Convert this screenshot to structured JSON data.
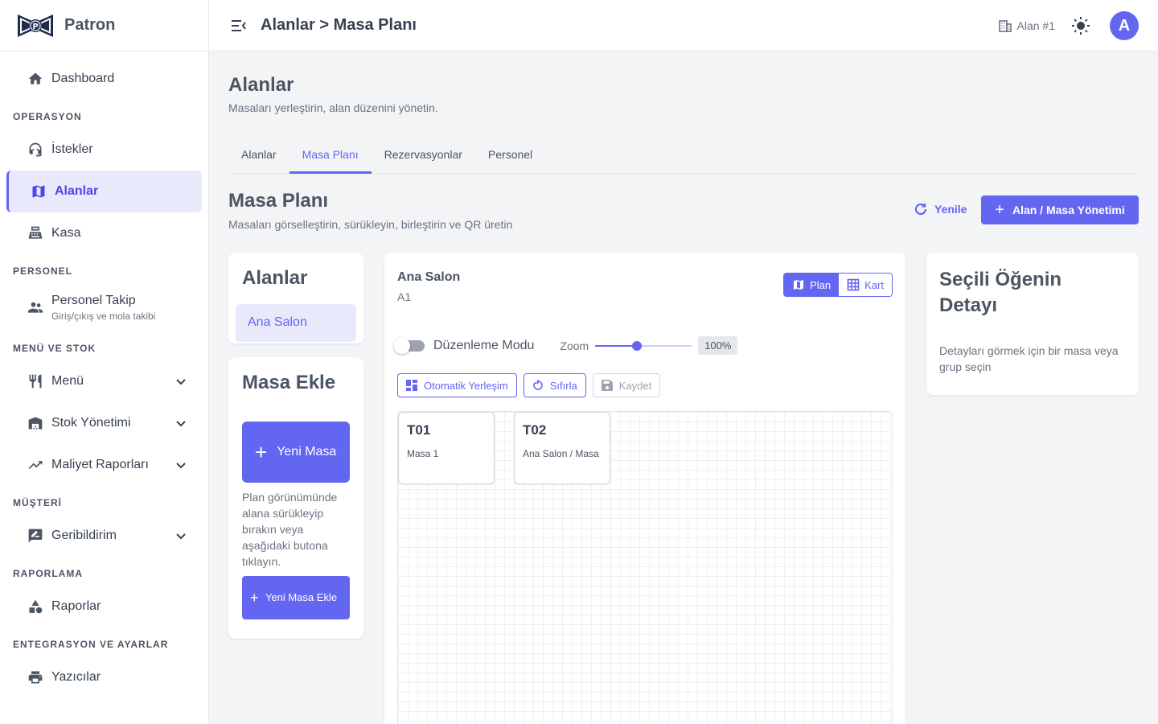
{
  "brand": {
    "name": "Patron"
  },
  "sidebar": {
    "dashboard": "Dashboard",
    "sections": {
      "operasyon": "OPERASYON",
      "personel": "PERSONEL",
      "menu_stok": "MENÜ VE STOK",
      "musteri": "MÜŞTERİ",
      "raporlama": "RAPORLAMA",
      "entegrasyon": "ENTEGRASYON VE AYARLAR"
    },
    "items": {
      "istekler": "İstekler",
      "alanlar": "Alanlar",
      "kasa": "Kasa",
      "personel_takip": "Personel Takip",
      "personel_takip_sub": "Giriş/çıkış ve mola takibi",
      "menu": "Menü",
      "stok": "Stok Yönetimi",
      "maliyet": "Maliyet Raporları",
      "geribildirim": "Geribildirim",
      "raporlar": "Raporlar",
      "yazicilar": "Yazıcılar"
    }
  },
  "topbar": {
    "breadcrumb": "Alanlar > Masa Planı",
    "area_chip": "Alan #1",
    "avatar_initial": "A"
  },
  "page": {
    "title": "Alanlar",
    "subtitle": "Masaları yerleştirin, alan düzenini yönetin.",
    "tabs": [
      "Alanlar",
      "Masa Planı",
      "Rezervasyonlar",
      "Personel"
    ],
    "active_tab": 1,
    "section_title": "Masa Planı",
    "section_subtitle": "Masaları görselleştirin, sürükleyin, birleştirin ve QR üretin",
    "refresh_label": "Yenile",
    "primary_label": "Alan / Masa Yönetimi"
  },
  "areas_card": {
    "title": "Alanlar",
    "items": [
      "Ana Salon"
    ]
  },
  "add_card": {
    "title": "Masa Ekle",
    "big_button": "Yeni Masa",
    "help": "Plan görünümünde alana sürükleyip bırakın veya aşağıdaki butona tıklayın.",
    "small_button": "Yeni Masa Ekle"
  },
  "plan": {
    "area_name": "Ana Salon",
    "area_code": "A1",
    "view_plan": "Plan",
    "view_card": "Kart",
    "edit_mode_label": "Düzenleme Modu",
    "edit_mode_on": false,
    "zoom_label": "Zoom",
    "zoom_percent": 100,
    "zoom_text": "100%",
    "auto_layout": "Otomatik Yerleşim",
    "reset": "Sıfırla",
    "save": "Kaydet",
    "tables": [
      {
        "code": "T01",
        "name": "Masa 1"
      },
      {
        "code": "T02",
        "name": "Ana Salon / Masa"
      }
    ]
  },
  "detail": {
    "title": "Seçili Öğenin Detayı",
    "hint": "Detayları görmek için bir masa veya grup seçin"
  },
  "colors": {
    "accent": "#6366f1",
    "accent_light": "#e8e9fb"
  }
}
